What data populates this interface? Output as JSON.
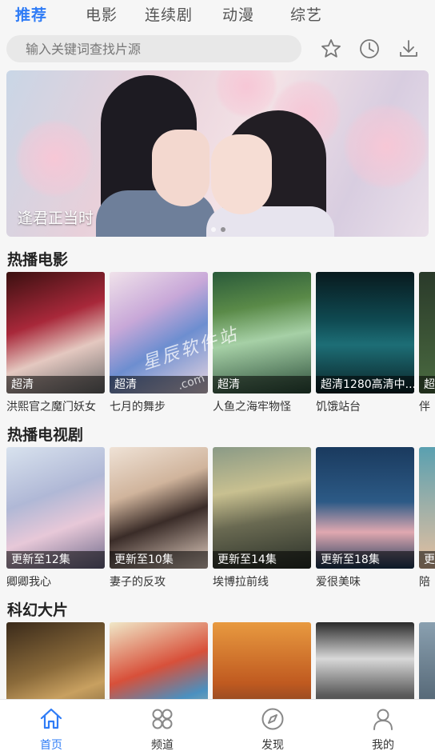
{
  "top_tabs": [
    "推荐",
    "电影",
    "连续剧",
    "动漫",
    "综艺"
  ],
  "search": {
    "placeholder": "输入关键词查找片源"
  },
  "header_icons": [
    "star-icon",
    "history-clock-icon",
    "download-icon"
  ],
  "banner": {
    "title": "逢君正当时"
  },
  "sections": [
    {
      "title": "热播电影",
      "items": [
        {
          "name": "洪熙官之魔门妖女",
          "badge": "超清"
        },
        {
          "name": "七月的舞步",
          "badge": "超清"
        },
        {
          "name": "人鱼之海牢物怪",
          "badge": "超清"
        },
        {
          "name": "饥饿站台",
          "badge": "超清1280高清中..."
        },
        {
          "name": "伴",
          "badge": "超"
        }
      ]
    },
    {
      "title": "热播电视剧",
      "items": [
        {
          "name": "卿卿我心",
          "badge": "更新至12集"
        },
        {
          "name": "妻子的反攻",
          "badge": "更新至10集"
        },
        {
          "name": "埃博拉前线",
          "badge": "更新至14集"
        },
        {
          "name": "爱很美味",
          "badge": "更新至18集"
        },
        {
          "name": "陪",
          "badge": "更"
        }
      ]
    },
    {
      "title": "科幻大片",
      "items": [
        {
          "name": "",
          "badge": ""
        },
        {
          "name": "",
          "badge": ""
        },
        {
          "name": "",
          "badge": ""
        },
        {
          "name": "",
          "badge": ""
        },
        {
          "name": "",
          "badge": ""
        }
      ]
    }
  ],
  "watermark": {
    "line1": "星辰软件站",
    "line2": ".com"
  },
  "bottom_tabs": [
    {
      "label": "首页",
      "icon": "home-icon",
      "active": true
    },
    {
      "label": "频道",
      "icon": "channels-grid-icon",
      "active": false
    },
    {
      "label": "发现",
      "icon": "compass-icon",
      "active": false
    },
    {
      "label": "我的",
      "icon": "profile-icon",
      "active": false
    }
  ],
  "colors": {
    "accent": "#2f7cf6",
    "background": "#f6f6f6"
  }
}
